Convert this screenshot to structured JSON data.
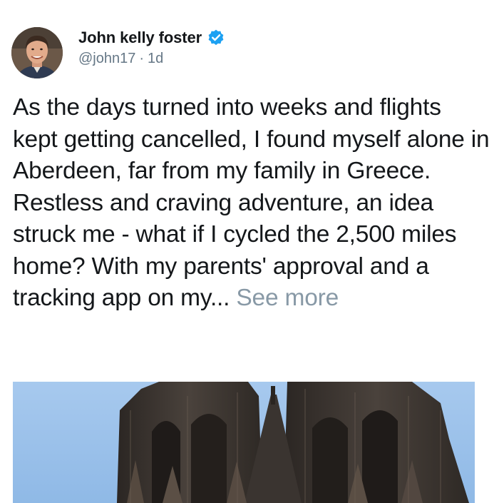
{
  "author": {
    "display_name": "John kelly foster",
    "handle": "@john17",
    "separator": "·",
    "time_ago": "1d",
    "verified_icon": "verified-badge-icon",
    "verified_color": "#1da1f2"
  },
  "tweet": {
    "text": "As the days turned into weeks and flights kept getting cancelled, I found myself alone in Aberdeen, far from my family in Greece. Restless and craving adventure, an idea struck me - what if I cycled the 2,500 miles home? With my parents' approval and a tracking app on my...",
    "see_more": "See more"
  },
  "colors": {
    "text": "#14171a",
    "secondary": "#657786",
    "see_more": "#8899a6",
    "sky": "#9cc3ec",
    "stone": "#3a3430"
  }
}
